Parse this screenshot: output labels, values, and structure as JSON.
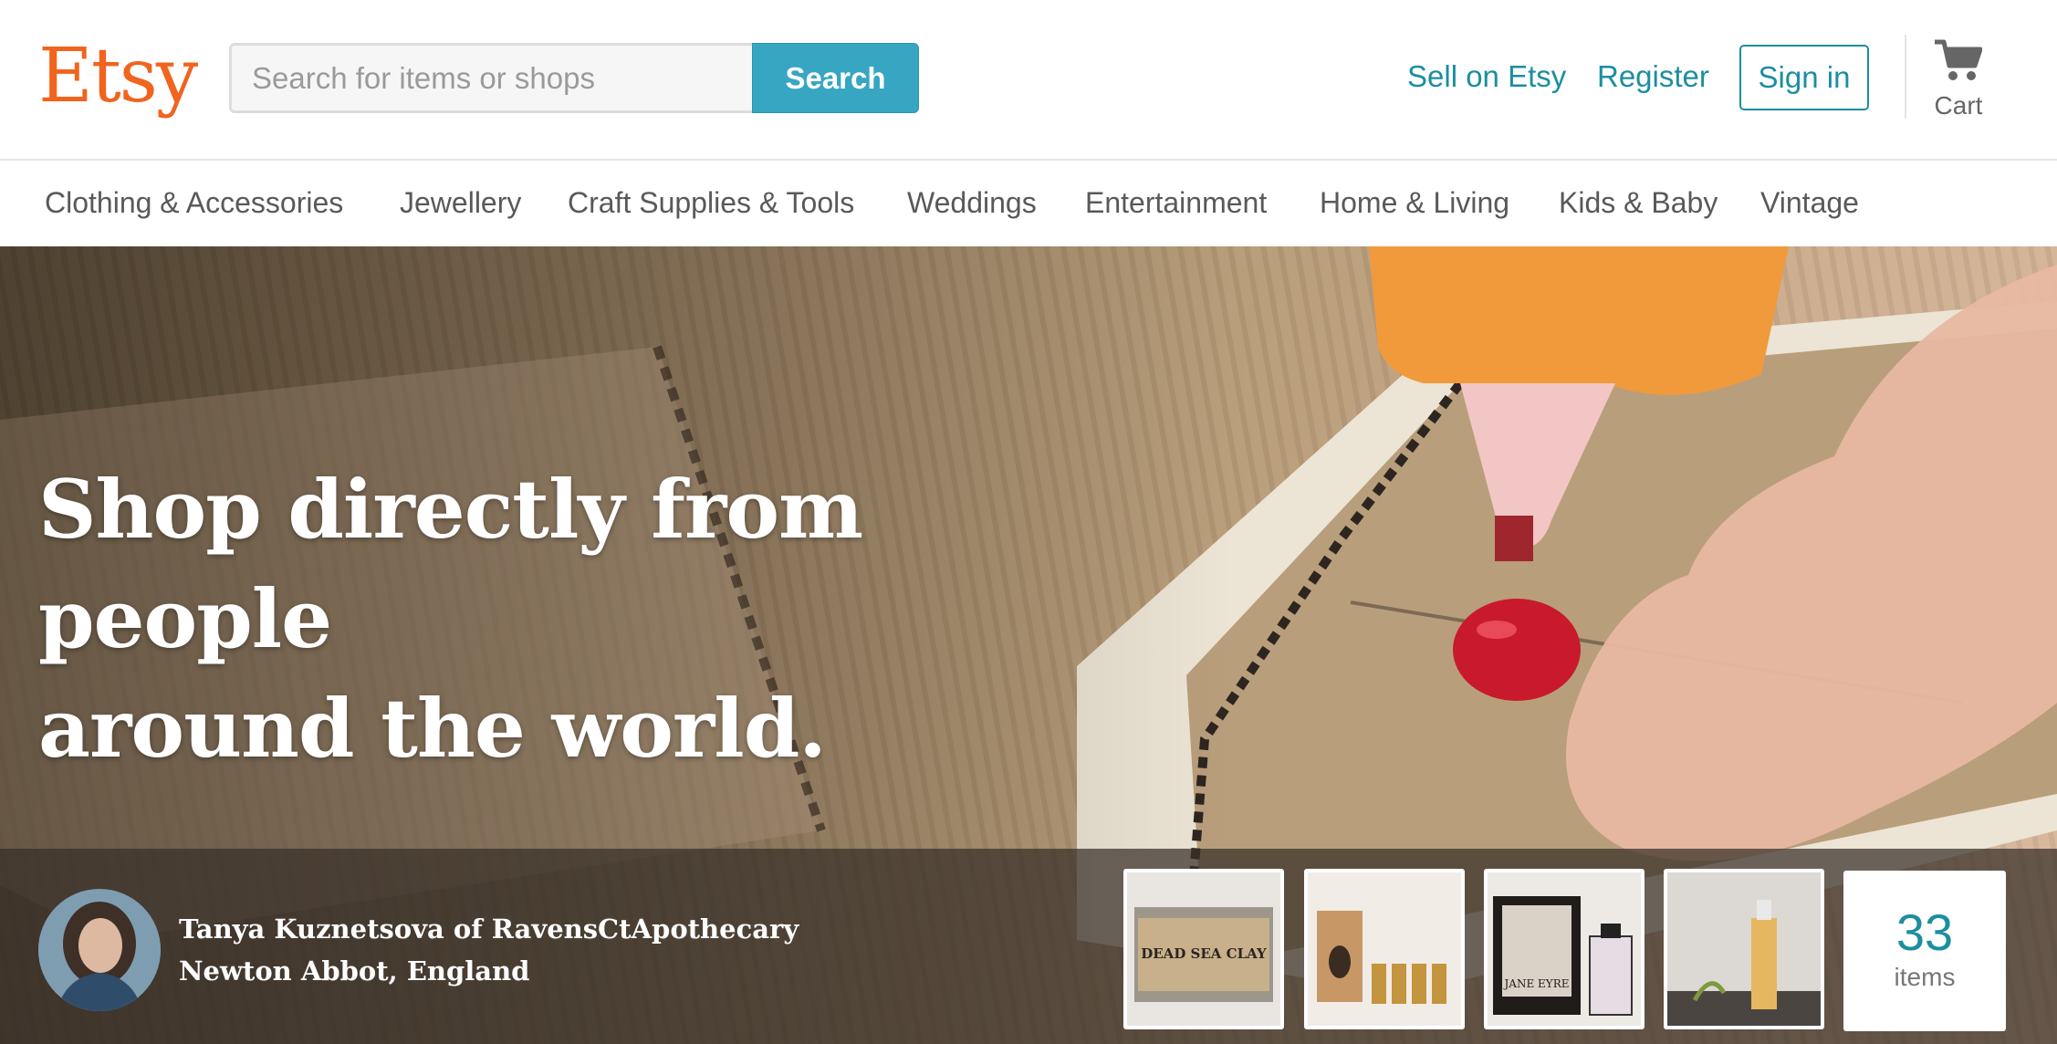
{
  "header": {
    "logo": "Etsy",
    "search": {
      "placeholder": "Search for items or shops",
      "value": "",
      "button_label": "Search"
    },
    "links": {
      "sell": "Sell on Etsy",
      "register": "Register",
      "sign_in": "Sign in"
    },
    "cart_label": "Cart"
  },
  "nav": {
    "items": [
      "Clothing & Accessories",
      "Jewellery",
      "Craft Supplies & Tools",
      "Weddings",
      "Entertainment",
      "Home & Living",
      "Kids & Baby",
      "Vintage"
    ]
  },
  "hero": {
    "headline_line1": "Shop directly from people",
    "headline_line2": "around the world.",
    "seller": {
      "name": "Tanya Kuznetsova of RavensCtApothecary",
      "location": "Newton Abbot, England"
    },
    "thumbnail_labels": {
      "thumb1": "DEAD SEA CLAY",
      "thumb3": "JANE EYRE"
    },
    "item_count": "33",
    "item_count_label": "items"
  },
  "colors": {
    "brand_orange": "#f1641e",
    "accent_teal": "#1c8ea0",
    "search_button": "#37a6c2"
  }
}
